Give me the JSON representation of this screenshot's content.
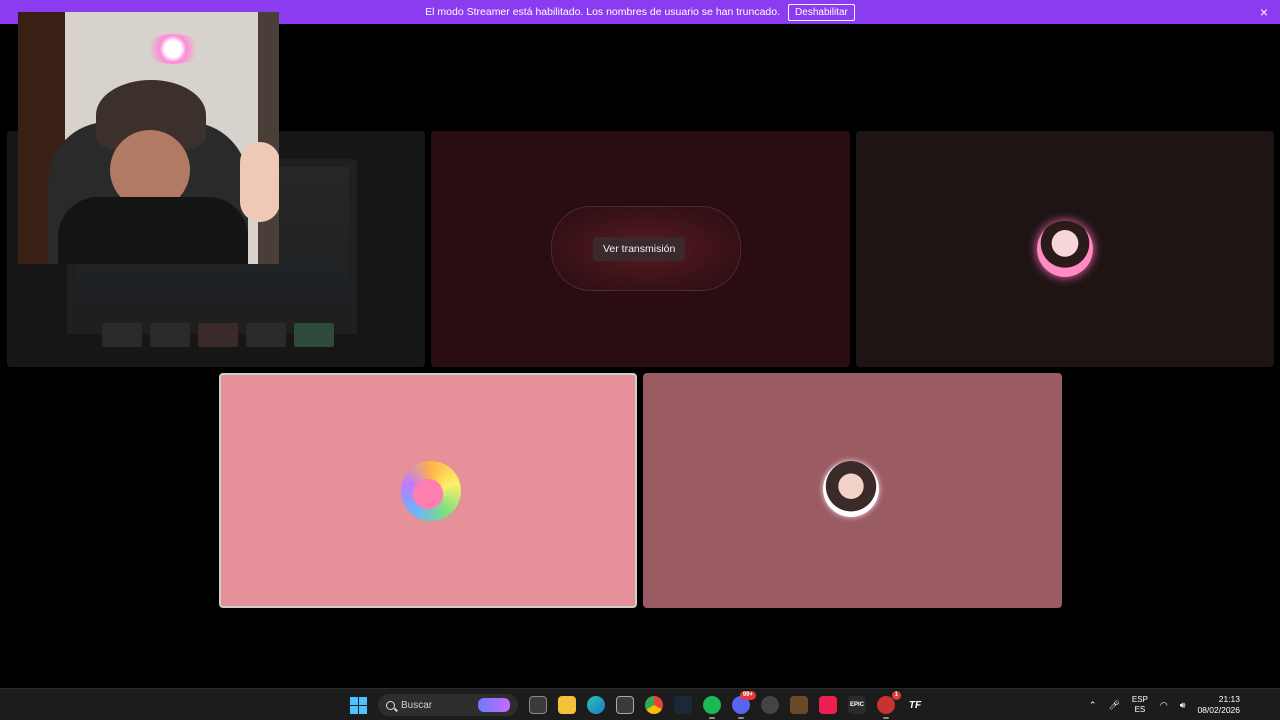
{
  "banner": {
    "message": "El modo Streamer está habilitado. Los nombres de usuario se han truncado.",
    "button_label": "Deshabilitar",
    "close_glyph": "×",
    "background_color": "#8c3cf0"
  },
  "call": {
    "tiles": [
      {
        "kind": "screen-share-preview"
      },
      {
        "kind": "stream",
        "watch_label": "Ver transmisión"
      },
      {
        "kind": "avatar"
      },
      {
        "kind": "avatar",
        "speaking": true,
        "color": "#e6909a"
      },
      {
        "kind": "avatar",
        "color": "#9a5c62"
      }
    ]
  },
  "taskbar": {
    "search_placeholder": "Buscar",
    "apps": [
      {
        "icon": "windows-start-icon"
      },
      {
        "icon": "search-icon"
      },
      {
        "icon": "task-view-icon"
      },
      {
        "icon": "file-explorer-icon"
      },
      {
        "icon": "edge-icon"
      },
      {
        "icon": "store-icon"
      },
      {
        "icon": "chrome-icon"
      },
      {
        "icon": "steam-icon"
      },
      {
        "icon": "spotify-icon"
      },
      {
        "icon": "discord-icon",
        "badge": "99+"
      },
      {
        "icon": "app-icon"
      },
      {
        "icon": "game-icon"
      },
      {
        "icon": "tiktok-icon"
      },
      {
        "icon": "epic-games-icon",
        "label": "EPIC"
      },
      {
        "icon": "app-red-icon",
        "badge": "1"
      },
      {
        "icon": "tf-icon",
        "label": "TF"
      }
    ],
    "tray": {
      "lang_top": "ESP",
      "lang_bottom": "ES",
      "time": "21:13",
      "date": "08/02/2026"
    }
  }
}
